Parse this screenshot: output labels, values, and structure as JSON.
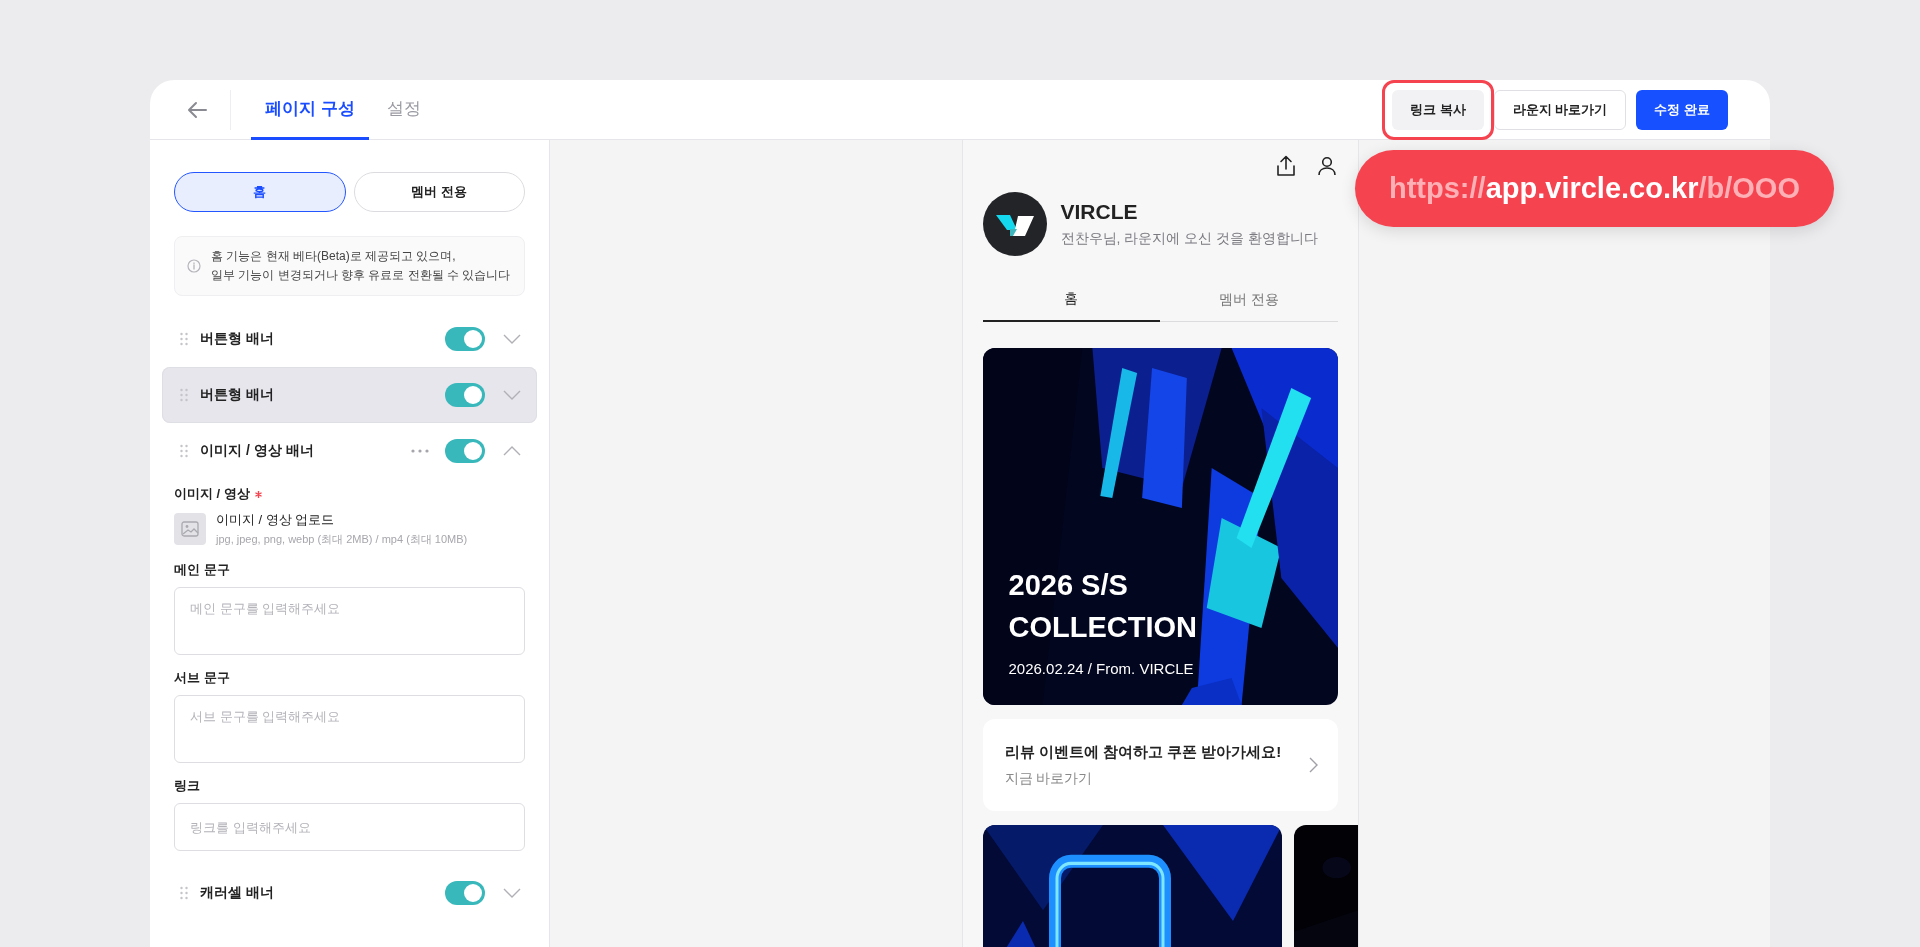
{
  "header": {
    "tabs": [
      {
        "label": "페이지 구성",
        "selected": true
      },
      {
        "label": "설정",
        "selected": false
      }
    ],
    "actions": [
      {
        "label": "링크 복사",
        "kind": "secondary",
        "highlighted": true
      },
      {
        "label": "라운지 바로가기",
        "kind": "outline",
        "highlighted": false
      },
      {
        "label": "수정 완료",
        "kind": "primary",
        "highlighted": false
      }
    ]
  },
  "url_callout": {
    "parts": [
      {
        "text": "https://",
        "emphasis": false
      },
      {
        "text": "app.vircle.co.kr",
        "emphasis": true
      },
      {
        "text": "/b/OOO",
        "emphasis": false
      }
    ]
  },
  "editor": {
    "segments": [
      {
        "label": "홈",
        "selected": true
      },
      {
        "label": "멤버 전용",
        "selected": false
      }
    ],
    "notice": [
      "홈 기능은 현재 베타(Beta)로 제공되고 있으며,",
      "일부 기능이 변경되거나 향후 유료로 전환될 수 있습니다"
    ],
    "sections": [
      {
        "title": "버튼형 배너",
        "on": true,
        "expanded": false,
        "highlighted": false,
        "menu": false
      },
      {
        "title": "버튼형 배너",
        "on": true,
        "expanded": false,
        "highlighted": true,
        "menu": false
      },
      {
        "title": "이미지 / 영상 배너",
        "on": true,
        "expanded": true,
        "highlighted": false,
        "menu": true,
        "fields": [
          {
            "kind": "upload",
            "label": "이미지 / 영상",
            "required": true,
            "title": "이미지 / 영상 업로드",
            "hint": "jpg, jpeg, png, webp (최대 2MB) / mp4 (최대 10MB)"
          },
          {
            "kind": "textarea",
            "label": "메인 문구",
            "required": false,
            "placeholder": "메인 문구를 입력해주세요"
          },
          {
            "kind": "textarea",
            "label": "서브 문구",
            "required": false,
            "placeholder": "서브 문구를 입력해주세요"
          },
          {
            "kind": "input",
            "label": "링크",
            "required": false,
            "placeholder": "링크를 입력해주세요"
          }
        ]
      },
      {
        "title": "캐러셀 배너",
        "on": true,
        "expanded": false,
        "highlighted": false,
        "menu": false
      }
    ]
  },
  "preview": {
    "brand": "VIRCLE",
    "greeting": "전찬우님, 라운지에 오신 것을 환영합니다",
    "tabs": [
      {
        "label": "홈",
        "selected": true
      },
      {
        "label": "멤버 전용",
        "selected": false
      }
    ],
    "hero": {
      "kind": "picture",
      "title_lines": [
        "2026 S/S",
        "COLLECTION"
      ],
      "subtitle": "2026.02.24 / From. VIRCLE"
    },
    "link_card": {
      "title": "리뷰 이벤트에 참여하고 쿠폰 받아가세요!",
      "subtitle": "지금 바로가기"
    }
  }
}
